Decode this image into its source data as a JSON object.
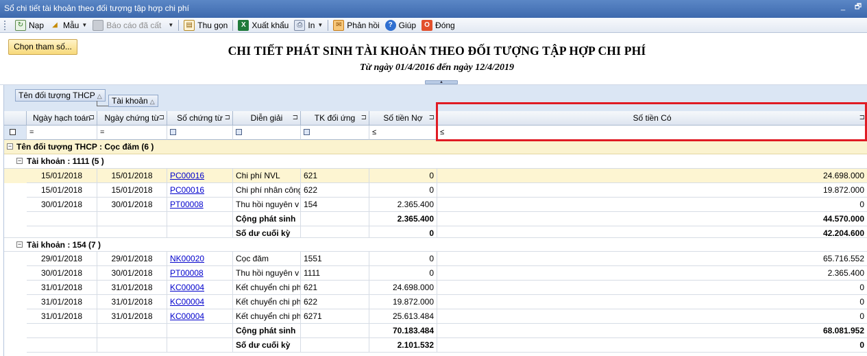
{
  "window": {
    "title": "Sổ chi tiết tài khoản theo đối tượng tập hợp chi phí",
    "min_glyph": "_",
    "restore_glyph": "🗗"
  },
  "toolbar": {
    "nap": "Nạp",
    "mau": "Mẫu",
    "bao_cao_da_cat": "Báo cáo đã cất",
    "thu_gon": "Thu gọn",
    "xuat_khau": "Xuất khẩu",
    "in": "In",
    "phan_hoi": "Phản hồi",
    "giup": "Giúp",
    "dong": "Đóng"
  },
  "report": {
    "choose_button": "Chọn tham số...",
    "title": "CHI TIẾT PHÁT SINH TÀI KHOẢN THEO ĐỐI TƯỢNG TẬP HỢP CHI PHÍ",
    "subtitle": "Từ ngày 01/4/2016 đến ngày 12/4/2019"
  },
  "group_panel": {
    "chip1": "Tên đối tượng THCP",
    "chip2": "Tài khoản"
  },
  "columns": {
    "ngay_hach_toan": "Ngày hạch toán",
    "ngay_chung_tu": "Ngày chứng từ",
    "so_chung_tu": "Số chứng từ",
    "dien_giai": "Diễn giải",
    "tk_doi_ung": "TK đối ứng",
    "so_tien_no": "Số tiền Nợ",
    "so_tien_co": "Số tiền Có"
  },
  "filters": {
    "eq": "=",
    "le": "≤"
  },
  "group1": {
    "label": "Tên đối tượng THCP : Cọc đăm (6 )",
    "accounts": [
      {
        "label": "Tài khoản : 1111 (5 )",
        "rows": [
          {
            "ngay_hach_toan": "15/01/2018",
            "ngay_chung_tu": "15/01/2018",
            "so_chung_tu": "PC00016",
            "dien_giai": "Chi phí NVL",
            "tk_doi_ung": "621",
            "no": "0",
            "co": "24.698.000"
          },
          {
            "ngay_hach_toan": "15/01/2018",
            "ngay_chung_tu": "15/01/2018",
            "so_chung_tu": "PC00016",
            "dien_giai": "Chi phí nhân công",
            "tk_doi_ung": "622",
            "no": "0",
            "co": "19.872.000"
          },
          {
            "ngay_hach_toan": "30/01/2018",
            "ngay_chung_tu": "30/01/2018",
            "so_chung_tu": "PT00008",
            "dien_giai": "Thu hồi nguyên v",
            "tk_doi_ung": "154",
            "no": "2.365.400",
            "co": "0"
          }
        ],
        "total_label": "Cộng phát sinh",
        "total_no": "2.365.400",
        "total_co": "44.570.000",
        "balance_label": "Số dư cuối kỳ",
        "balance_no": "0",
        "balance_co": "42.204.600"
      },
      {
        "label": "Tài khoản : 154 (7 )",
        "rows": [
          {
            "ngay_hach_toan": "29/01/2018",
            "ngay_chung_tu": "29/01/2018",
            "so_chung_tu": "NK00020",
            "dien_giai": "Cọc đăm",
            "tk_doi_ung": "1551",
            "no": "0",
            "co": "65.716.552"
          },
          {
            "ngay_hach_toan": "30/01/2018",
            "ngay_chung_tu": "30/01/2018",
            "so_chung_tu": "PT00008",
            "dien_giai": "Thu hồi nguyên v",
            "tk_doi_ung": "1111",
            "no": "0",
            "co": "2.365.400"
          },
          {
            "ngay_hach_toan": "31/01/2018",
            "ngay_chung_tu": "31/01/2018",
            "so_chung_tu": "KC00004",
            "dien_giai": "Kết chuyển chi ph",
            "tk_doi_ung": "621",
            "no": "24.698.000",
            "co": "0"
          },
          {
            "ngay_hach_toan": "31/01/2018",
            "ngay_chung_tu": "31/01/2018",
            "so_chung_tu": "KC00004",
            "dien_giai": "Kết chuyển chi ph",
            "tk_doi_ung": "622",
            "no": "19.872.000",
            "co": "0"
          },
          {
            "ngay_hach_toan": "31/01/2018",
            "ngay_chung_tu": "31/01/2018",
            "so_chung_tu": "KC00004",
            "dien_giai": "Kết chuyển chi ph",
            "tk_doi_ung": "6271",
            "no": "25.613.484",
            "co": "0"
          }
        ],
        "total_label": "Cộng phát sinh",
        "total_no": "70.183.484",
        "total_co": "68.081.952",
        "balance_label": "Số dư cuối kỳ",
        "balance_no": "2.101.532",
        "balance_co": "0"
      }
    ]
  },
  "colors": {
    "highlight": "#e01b24",
    "link": "#0000cc",
    "selected_row": "#fdf5d2"
  }
}
